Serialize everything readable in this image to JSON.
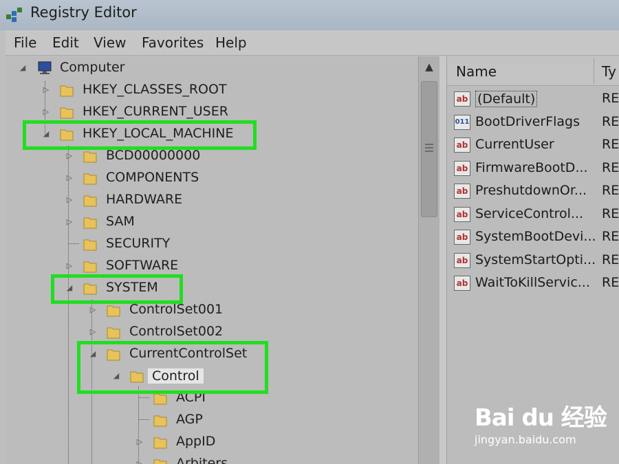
{
  "window": {
    "title": "Registry Editor"
  },
  "menu": [
    "File",
    "Edit",
    "View",
    "Favorites",
    "Help"
  ],
  "tree": {
    "root": "Computer",
    "hives": [
      "HKEY_CLASSES_ROOT",
      "HKEY_CURRENT_USER",
      "HKEY_LOCAL_MACHINE"
    ],
    "hklm_children": [
      "BCD00000000",
      "COMPONENTS",
      "HARDWARE",
      "SAM",
      "SECURITY",
      "SOFTWARE",
      "SYSTEM"
    ],
    "system_children": [
      "ControlSet001",
      "ControlSet002",
      "CurrentControlSet"
    ],
    "ccs_children": [
      "Control"
    ],
    "control_children": [
      "ACPI",
      "AGP",
      "AppID",
      "Arbiters"
    ]
  },
  "values_pane": {
    "columns": {
      "name": "Name",
      "type": "Ty"
    },
    "rows": [
      {
        "name": "(Default)",
        "type": "RE",
        "icon": "string-value-icon"
      },
      {
        "name": "BootDriverFlags",
        "type": "RE",
        "icon": "binary-value-icon"
      },
      {
        "name": "CurrentUser",
        "type": "RE",
        "icon": "string-value-icon"
      },
      {
        "name": "FirmwareBootD...",
        "type": "RE",
        "icon": "string-value-icon"
      },
      {
        "name": "PreshutdownOr...",
        "type": "RE",
        "icon": "string-value-icon"
      },
      {
        "name": "ServiceControl...",
        "type": "RE",
        "icon": "string-value-icon"
      },
      {
        "name": "SystemBootDevi...",
        "type": "RE",
        "icon": "string-value-icon"
      },
      {
        "name": "SystemStartOpti...",
        "type": "RE",
        "icon": "string-value-icon"
      },
      {
        "name": "WaitToKillServic...",
        "type": "RE",
        "icon": "string-value-icon"
      }
    ]
  },
  "icon_glyphs": {
    "string": "ab",
    "binary": "011"
  },
  "watermark": {
    "logo": "Bai du 经验",
    "url": "jingyan.baidu.com"
  },
  "colors": {
    "highlight": "#22dd22",
    "folder": "#e8c25a"
  }
}
